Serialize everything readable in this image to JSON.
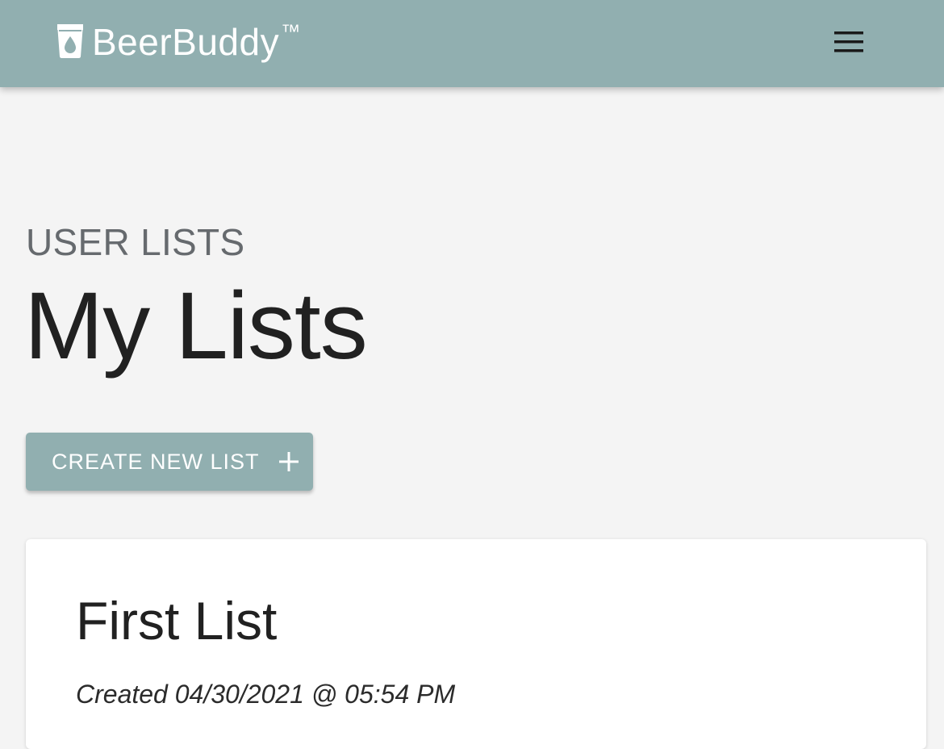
{
  "header": {
    "brand_name": "BeerBuddy",
    "brand_tm": "™",
    "brand_icon": "beer-glass-icon",
    "menu_icon": "hamburger-menu-icon",
    "background_color": "#91afb0"
  },
  "main": {
    "overline": "USER LISTS",
    "title": "My Lists",
    "create_button": {
      "label": "CREATE NEW LIST",
      "icon": "plus-icon"
    },
    "lists": [
      {
        "title": "First List",
        "created": "Created 04/30/2021 @ 05:54 PM"
      }
    ]
  },
  "colors": {
    "accent": "#91afb0",
    "page_background": "#f4f4f4",
    "card_background": "#ffffff",
    "text_primary": "#212121",
    "text_secondary": "#666a6e"
  }
}
